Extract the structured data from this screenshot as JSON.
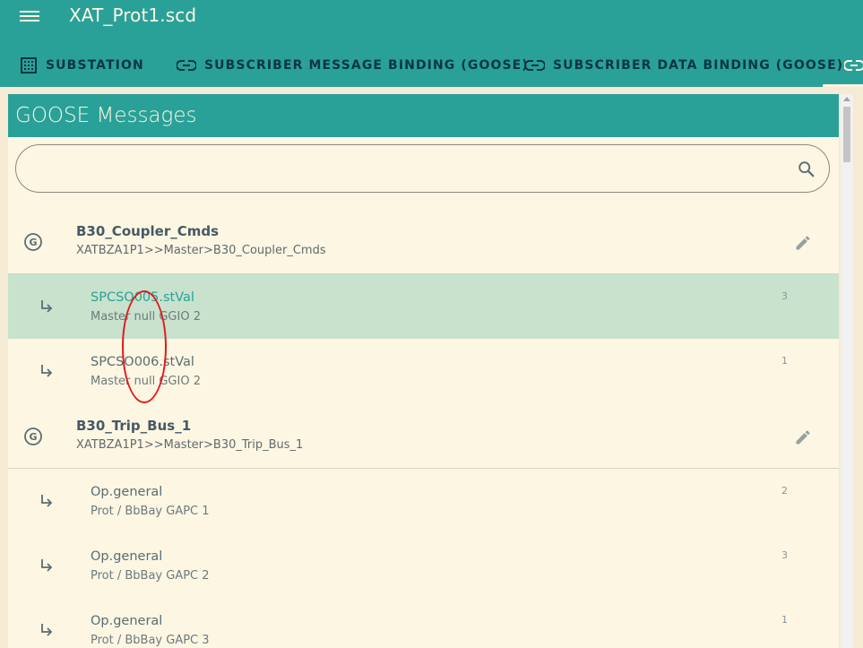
{
  "app": {
    "title": "XAT_Prot1.scd",
    "menu_icon": "menu-icon"
  },
  "tabs": [
    {
      "label": "SUBSTATION",
      "icon": "grid-icon"
    },
    {
      "label": "SUBSCRIBER MESSAGE BINDING (GOOSE)",
      "icon": "link-icon"
    },
    {
      "label": "SUBSCRIBER DATA BINDING (GOOSE)",
      "icon": "link-icon"
    },
    {
      "label": "",
      "icon": "link-icon",
      "active": true
    }
  ],
  "panel": {
    "title": "GOOSE Messages",
    "search": {
      "value": "",
      "placeholder": ""
    }
  },
  "groups": [
    {
      "title": "B30_Coupler_Cmds",
      "path": "XATBZA1P1>>Master>B30_Coupler_Cmds",
      "items": [
        {
          "title": "SPCSO005.stVal",
          "subtitle": "Master null GGIO 2",
          "count": "3",
          "selected": true
        },
        {
          "title": "SPCSO006.stVal",
          "subtitle": "Master null GGIO 2",
          "count": "1",
          "selected": false
        }
      ]
    },
    {
      "title": "B30_Trip_Bus_1",
      "path": "XATBZA1P1>>Master>B30_Trip_Bus_1",
      "items": [
        {
          "title": "Op.general",
          "subtitle": "Prot / BbBay GAPC 1",
          "count": "2",
          "selected": false
        },
        {
          "title": "Op.general",
          "subtitle": "Prot / BbBay GAPC 2",
          "count": "3",
          "selected": false
        },
        {
          "title": "Op.general",
          "subtitle": "Prot / BbBay GAPC 3",
          "count": "1",
          "selected": false
        }
      ]
    }
  ],
  "colors": {
    "primary": "#2aa198",
    "background": "#fdf6e3",
    "selected_row": "#c8e2cd",
    "annotation": "#e01b1b"
  }
}
